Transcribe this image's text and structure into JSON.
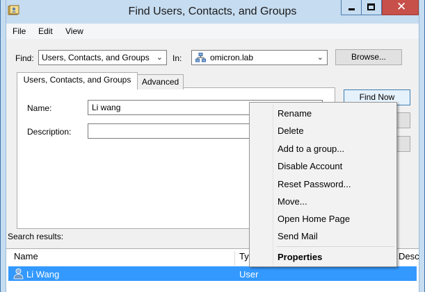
{
  "window": {
    "title": "Find Users, Contacts, and Groups",
    "close_glyph": "✕"
  },
  "menu": [
    "File",
    "Edit",
    "View"
  ],
  "find": {
    "find_label": "Find:",
    "find_value": "Users, Contacts, and Groups",
    "in_label": "In:",
    "in_value": "omicron.lab",
    "browse_label": "Browse..."
  },
  "tabs": [
    "Users, Contacts, and Groups",
    "Advanced"
  ],
  "fields": {
    "name_label": "Name:",
    "name_value": "Li wang",
    "description_label": "Description:",
    "description_value": ""
  },
  "buttons": {
    "find_now": "Find Now"
  },
  "results": {
    "label": "Search results:",
    "columns": [
      "Name",
      "Ty",
      "Desc"
    ],
    "rows": [
      {
        "name": "Li Wang",
        "type": "User"
      }
    ]
  },
  "context_menu": {
    "items": [
      "Rename",
      "Delete",
      "Add to a group...",
      "Disable Account",
      "Reset Password...",
      "Move...",
      "Open Home Page",
      "Send Mail"
    ],
    "default_item": "Properties"
  },
  "colors": {
    "selection": "#3399ff",
    "title_bar": "#c6dcf0",
    "close_button": "#c7504a"
  },
  "icons": {
    "app": "address-book-icon",
    "domain": "domain-tree-icon",
    "user": "user-icon"
  }
}
